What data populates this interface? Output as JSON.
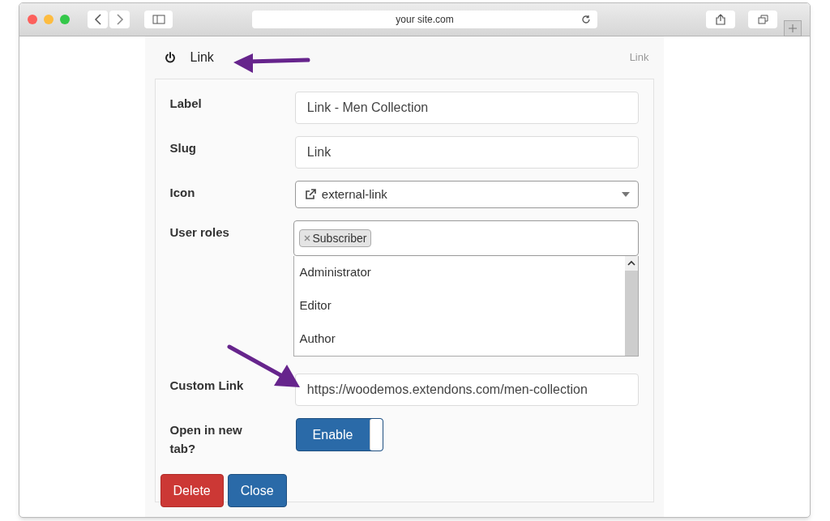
{
  "browser": {
    "address": "your site.com"
  },
  "panel": {
    "title": "Link",
    "badge": "Link"
  },
  "fields": [
    {
      "kind": "text",
      "label": "Label",
      "value": "Link - Men Collection"
    },
    {
      "kind": "text",
      "label": "Slug",
      "value": "Link"
    },
    {
      "kind": "select",
      "label": "Icon",
      "value": "external-link"
    },
    {
      "kind": "tags",
      "label": "User roles",
      "tags": [
        "Subscriber"
      ],
      "options": [
        "Administrator",
        "Editor",
        "Author"
      ]
    },
    {
      "kind": "text",
      "label": "Custom Link",
      "value": "https://woodemos.extendons.com/men-collection"
    },
    {
      "kind": "toggle",
      "label": "Open in new tab?",
      "value": "Enable",
      "on": true
    }
  ],
  "buttons": [
    {
      "label": "Delete",
      "kind": "danger"
    },
    {
      "label": "Close",
      "kind": "primary"
    }
  ]
}
